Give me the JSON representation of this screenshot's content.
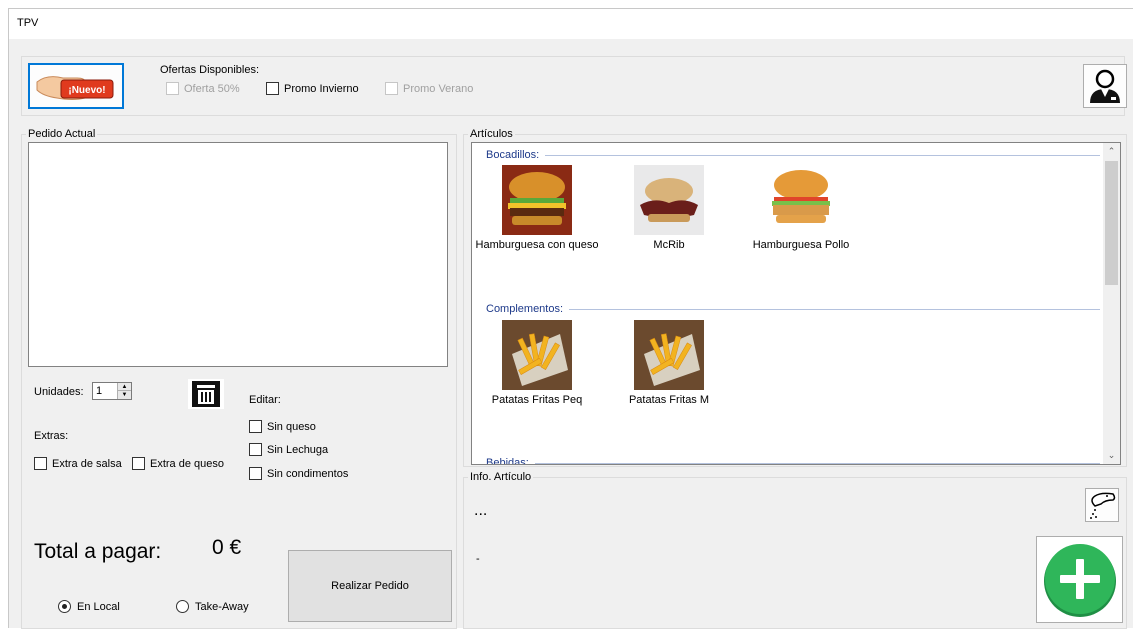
{
  "window": {
    "title": "TPV"
  },
  "toolbar": {
    "new_button_label": "¡Nuevo!",
    "offers_label": "Ofertas Disponibles:",
    "offers": [
      {
        "label": "Oferta 50%",
        "checked": false,
        "enabled": false
      },
      {
        "label": "Promo Invierno",
        "checked": false,
        "enabled": true
      },
      {
        "label": "Promo Verano",
        "checked": false,
        "enabled": false
      }
    ]
  },
  "order": {
    "group_label": "Pedido Actual",
    "units_label": "Unidades:",
    "units_value": "1",
    "extras_label": "Extras:",
    "extras": [
      {
        "label": "Extra de salsa",
        "checked": false
      },
      {
        "label": "Extra de queso",
        "checked": false
      }
    ],
    "edit_label": "Editar:",
    "edits": [
      {
        "label": "Sin queso",
        "checked": false
      },
      {
        "label": "Sin Lechuga",
        "checked": false
      },
      {
        "label": "Sin condimentos",
        "checked": false
      }
    ],
    "total_label": "Total a pagar:",
    "total_value": "0 €",
    "place_options": [
      {
        "label": "En Local",
        "selected": true
      },
      {
        "label": "Take-Away",
        "selected": false
      }
    ],
    "submit_label": "Realizar Pedido"
  },
  "articles": {
    "group_label": "Artículos",
    "sections": [
      {
        "title": "Bocadillos:",
        "items": [
          {
            "name": "Hamburguesa con queso"
          },
          {
            "name": "McRib"
          },
          {
            "name": "Hamburguesa Pollo"
          }
        ]
      },
      {
        "title": "Complementos:",
        "items": [
          {
            "name": "Patatas Fritas Peq"
          },
          {
            "name": "Patatas Fritas M"
          }
        ]
      },
      {
        "title": "Bebidas:",
        "items": []
      }
    ]
  },
  "info": {
    "group_label": "Info. Artículo",
    "title_text": "...",
    "detail_text": "-"
  },
  "colors": {
    "accent_blue": "#1e3a8a",
    "add_green": "#2fb65a",
    "selection_blue": "#0078d7"
  }
}
